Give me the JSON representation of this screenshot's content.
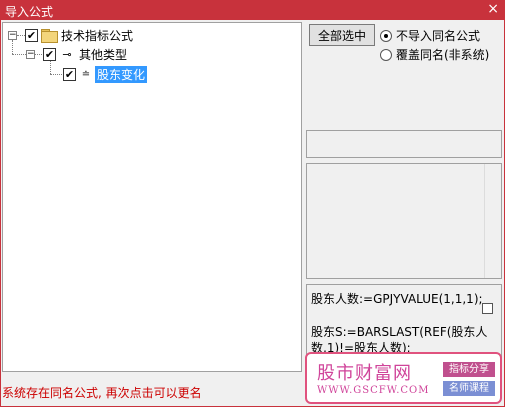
{
  "window": {
    "title": "导入公式",
    "close_glyph": "×"
  },
  "tree": {
    "nodes": [
      {
        "label": "技术指标公式",
        "checked": "✔",
        "expander": "−"
      },
      {
        "label": "其他类型",
        "checked": "✔",
        "expander": "−"
      },
      {
        "label": "股东变化",
        "checked": "✔"
      }
    ]
  },
  "actions": {
    "select_all_label": "全部选中"
  },
  "options": {
    "no_import_same_name": "不导入同名公式",
    "overwrite_same_name": "覆盖同名(非系统)",
    "selected": "no_import_same_name"
  },
  "code": {
    "line1": "股东人数:=GPJYVALUE(1,1,1);",
    "line2": "股东S:=BARSLAST(REF(股东人",
    "line3": "数,1)!=股东人数);"
  },
  "status_message": "系统存在同名公式, 再次点击可以更名",
  "watermark": {
    "site_name": "股市财富网",
    "url": "WWW.GSCFW.COM",
    "tag1": "指标分享",
    "tag2": "名师课程"
  },
  "icons": {
    "folder": "folder-icon",
    "key": "key-icon",
    "formula": "formula-icon"
  },
  "colors": {
    "titlebar": "#c8323c",
    "selection": "#3399ff",
    "status": "#cc0000"
  }
}
